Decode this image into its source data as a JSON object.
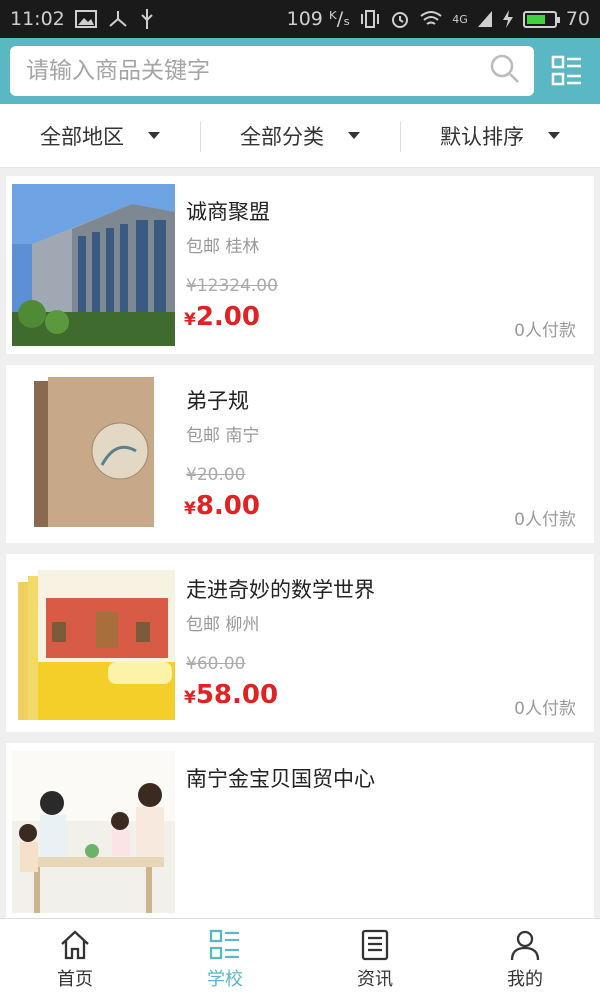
{
  "status_bar": {
    "time": "11:02",
    "speed": "109 ᴷ/ₛ",
    "signal": "4G",
    "battery": "70",
    "battery_level": 0.7
  },
  "search": {
    "placeholder": "请输入商品关键字"
  },
  "filters": [
    {
      "label": "全部地区"
    },
    {
      "label": "全部分类"
    },
    {
      "label": "默认排序"
    }
  ],
  "products": [
    {
      "title": "诚商聚盟",
      "meta": "包邮 桂林",
      "old_price": "¥12324.00",
      "price": "2.00",
      "currency": "¥",
      "paid": "0人付款",
      "thumb_icon": "building-photo"
    },
    {
      "title": "弟子规",
      "meta": "包邮 南宁",
      "old_price": "¥20.00",
      "price": "8.00",
      "currency": "¥",
      "paid": "0人付款",
      "thumb_icon": "book-cover"
    },
    {
      "title": "走进奇妙的数学世界",
      "meta": "包邮 柳州",
      "old_price": "¥60.00",
      "price": "58.00",
      "currency": "¥",
      "paid": "0人付款",
      "thumb_icon": "book-set"
    },
    {
      "title": "南宁金宝贝国贸中心",
      "thumb_icon": "family-photo"
    }
  ],
  "tabs": [
    {
      "label": "首页",
      "icon": "home-icon",
      "active": false
    },
    {
      "label": "学校",
      "icon": "grid-list-icon",
      "active": true
    },
    {
      "label": "资讯",
      "icon": "news-icon",
      "active": false
    },
    {
      "label": "我的",
      "icon": "user-icon",
      "active": false
    }
  ],
  "colors": {
    "accent": "#5ab7c4",
    "price": "#e02222"
  }
}
